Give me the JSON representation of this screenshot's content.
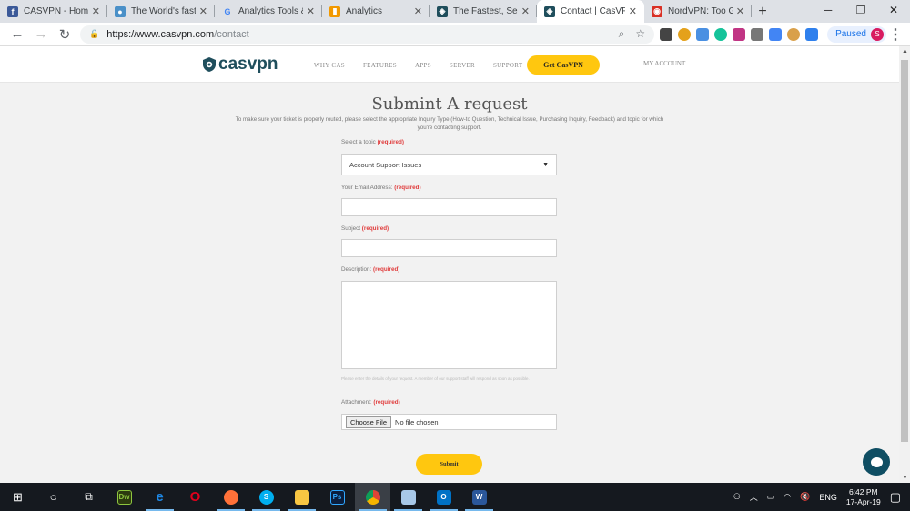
{
  "browser": {
    "tabs": [
      {
        "label": "CASVPN - Home |",
        "icon": "facebook-icon",
        "color": "#3b5998",
        "glyph": "f"
      },
      {
        "label": "The World's fastest",
        "icon": "globe-icon",
        "color": "#4a90c8",
        "glyph": "●"
      },
      {
        "label": "Analytics Tools & S",
        "icon": "google-icon",
        "color": "#ffffff",
        "glyph": "G"
      },
      {
        "label": "Analytics",
        "icon": "analytics-icon",
        "color": "#f29900",
        "glyph": "▮"
      },
      {
        "label": "The Fastest, Secure",
        "icon": "casvpn-shield-icon",
        "color": "#1f4e5c",
        "glyph": "◈"
      },
      {
        "label": "Contact | CasVPN",
        "icon": "casvpn-shield-icon",
        "color": "#1f4e5c",
        "glyph": "◈"
      },
      {
        "label": "NordVPN: Too Good",
        "icon": "nordvpn-icon",
        "color": "#d93025",
        "glyph": "◉"
      }
    ],
    "active_tab": 5,
    "url_host": "https://www.casvpn.com",
    "url_path": "/contact",
    "profile_status": "Paused",
    "profile_initial": "S"
  },
  "site": {
    "nav": [
      "WHY CAS",
      "FEATURES",
      "APPS",
      "SERVER",
      "SUPPORT"
    ],
    "cta": "Get CasVPN",
    "account": "MY ACCOUNT",
    "logo": "casvpn",
    "brand_color": "#1f4e5c",
    "accent": "#ffc70f"
  },
  "form": {
    "title": "Submint A request",
    "intro": "To make sure your ticket is properly routed, please select the appropriate Inquiry Type (How-to Question, Technical Issue, Purchasing Inquiry, Feedback) and topic for which you're contacting support.",
    "required": "(required)",
    "topic_label": "Select a topic",
    "topic_value": "Account Support Issues",
    "email_label": "Your Email Address:",
    "email_value": "",
    "subject_label": "Subject",
    "subject_value": "",
    "desc_label": "Description:",
    "desc_value": "",
    "desc_hint": "Please enter the details of your request. A member of our support staff will respond as soon as possible.",
    "attach_label": "Attachment:",
    "choose_file": "Choose File",
    "no_file": "No file chosen",
    "submit": "Submit"
  },
  "taskbar": {
    "time": "6:42 PM",
    "date": "17-Apr-19",
    "lang": "ENG"
  }
}
